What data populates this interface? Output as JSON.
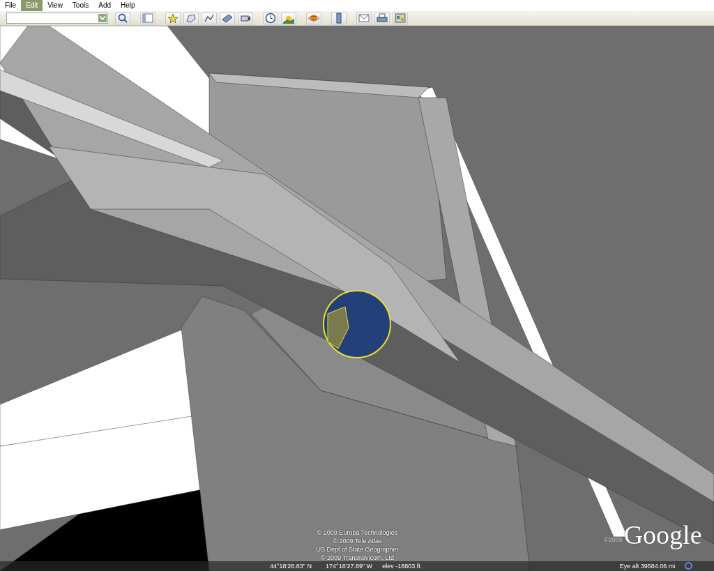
{
  "menu": [
    {
      "label": "File",
      "selected": false
    },
    {
      "label": "Edit",
      "selected": true
    },
    {
      "label": "View",
      "selected": false
    },
    {
      "label": "Tools",
      "selected": false
    },
    {
      "label": "Add",
      "selected": false
    },
    {
      "label": "Help",
      "selected": false
    }
  ],
  "credits": [
    "© 2009 Europa Technologies",
    "© 2009 Tele Atlas",
    "US Dept of State Geographer",
    "© 2009 Transnavicom, Ltd"
  ],
  "logo": {
    "copyright": "©2009",
    "text": "Google"
  },
  "status_bar": {
    "latitude": "44°18'28.83\" N",
    "longitude": "174°18'27.89\" W",
    "elevation": "elev -18803 ft",
    "eye_altitude": "Eye alt 39584.06 mi"
  }
}
